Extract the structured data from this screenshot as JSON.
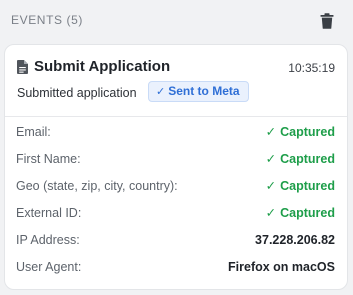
{
  "header": {
    "title": "EVENTS (5)",
    "delete_icon": "trash-icon"
  },
  "event": {
    "icon": "document-icon",
    "name": "Submit Application",
    "time": "10:35:19",
    "description": "Submitted application",
    "badge": {
      "check": "✓",
      "label": "Sent to Meta",
      "color": "#2f6fd6"
    },
    "fields": [
      {
        "label": "Email:",
        "check": "✓",
        "value": "Captured"
      },
      {
        "label": "First Name:",
        "check": "✓",
        "value": "Captured"
      },
      {
        "label": "Geo (state, zip, city, country):",
        "check": "✓",
        "value": "Captured"
      },
      {
        "label": "External ID:",
        "check": "✓",
        "value": "Captured"
      },
      {
        "label": "IP Address:",
        "value": "37.228.206.82"
      },
      {
        "label": "User Agent:",
        "value": "Firefox on macOS"
      }
    ],
    "captured_color": "#1e9e4a"
  }
}
